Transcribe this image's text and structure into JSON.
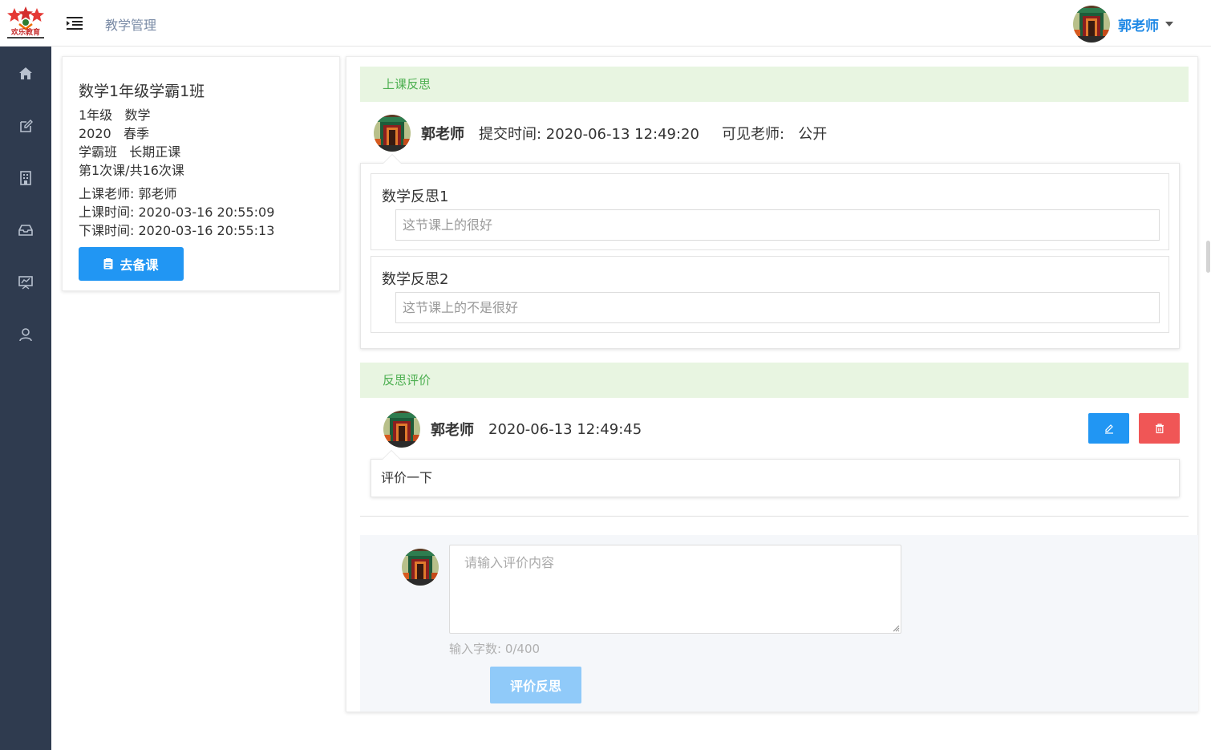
{
  "header": {
    "logo_text": "欢乐教育",
    "breadcrumb": "教学管理",
    "user_name": "郭老师"
  },
  "sidebar": {
    "items": [
      {
        "icon": "home-icon"
      },
      {
        "icon": "edit-icon"
      },
      {
        "icon": "building-icon"
      },
      {
        "icon": "inbox-icon"
      },
      {
        "icon": "presentation-icon"
      },
      {
        "icon": "user-icon"
      }
    ]
  },
  "class_card": {
    "title": "数学1年级学霸1班",
    "grade_subject": "1年级   数学",
    "year_term": "2020   春季",
    "class_type": "学霸班   长期正课",
    "lesson_progress": "第1次课/共16次课",
    "teacher": "上课老师: 郭老师",
    "start_time": "上课时间: 2020-03-16 20:55:09",
    "end_time": "下课时间: 2020-03-16 20:55:13",
    "prep_button": "去备课"
  },
  "reflection": {
    "section_title": "上课反思",
    "author": "郭老师",
    "submit_time": "提交时间: 2020-06-13 12:49:20",
    "visibility": "可见老师:   公开",
    "items": [
      {
        "label": "数学反思1",
        "value": "这节课上的很好"
      },
      {
        "label": "数学反思2",
        "value": "这节课上的不是很好"
      }
    ]
  },
  "evaluation": {
    "section_title": "反思评价",
    "author": "郭老师",
    "time": "2020-06-13 12:49:45",
    "content": "评价一下"
  },
  "compose": {
    "placeholder": "请输入评价内容",
    "counter": "输入字数: 0/400",
    "submit_label": "评价反思"
  },
  "colors": {
    "sidebar_bg": "#2f3b4f",
    "primary": "#2196f3",
    "danger": "#f05656",
    "section_bg": "#e8f5e1",
    "section_text": "#4caf50",
    "user_name": "#1e88e5"
  }
}
